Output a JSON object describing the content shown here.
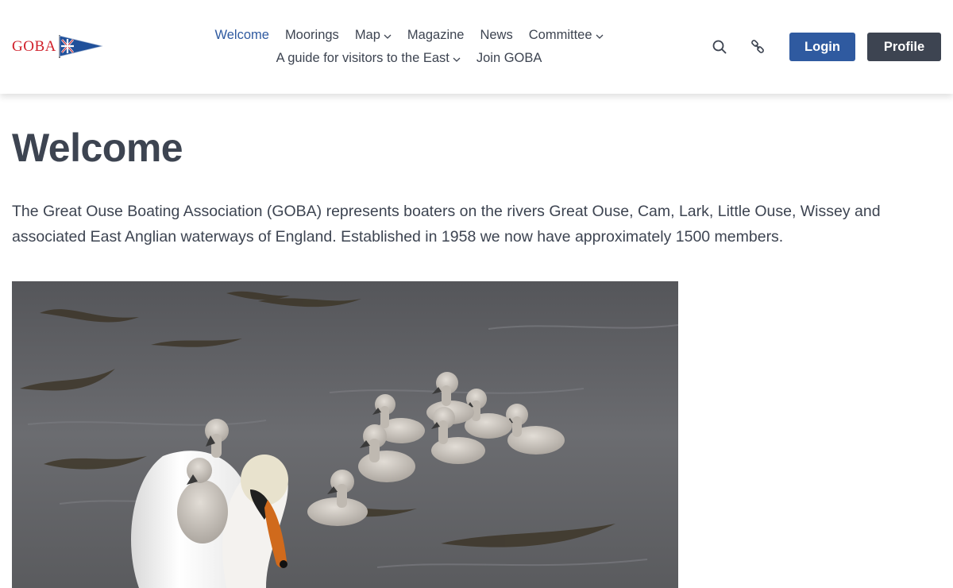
{
  "site": {
    "logo_text": "GOBA",
    "colors": {
      "accent": "#2f5aa0",
      "text": "#3d4451",
      "logo_red": "#d0202a"
    }
  },
  "nav": {
    "items_row1": [
      {
        "label": "Welcome",
        "active": true
      },
      {
        "label": "Moorings"
      },
      {
        "label": "Map",
        "has_dropdown": true
      },
      {
        "label": "Magazine"
      },
      {
        "label": "News"
      },
      {
        "label": "Committee",
        "has_dropdown": true
      }
    ],
    "items_row2": [
      {
        "label": "A guide for visitors to the East",
        "has_dropdown": true
      },
      {
        "label": "Join GOBA"
      }
    ]
  },
  "header_actions": {
    "search_icon": "search-icon",
    "link_icon": "link-icon",
    "login_label": "Login",
    "profile_label": "Profile"
  },
  "main": {
    "title": "Welcome",
    "intro": "The Great Ouse Boating Association (GOBA) represents boaters on the rivers Great Ouse, Cam, Lark, Little Ouse, Wissey and associated East Anglian waterways of England. Established in 1958 we now have approximately 1500 members."
  }
}
